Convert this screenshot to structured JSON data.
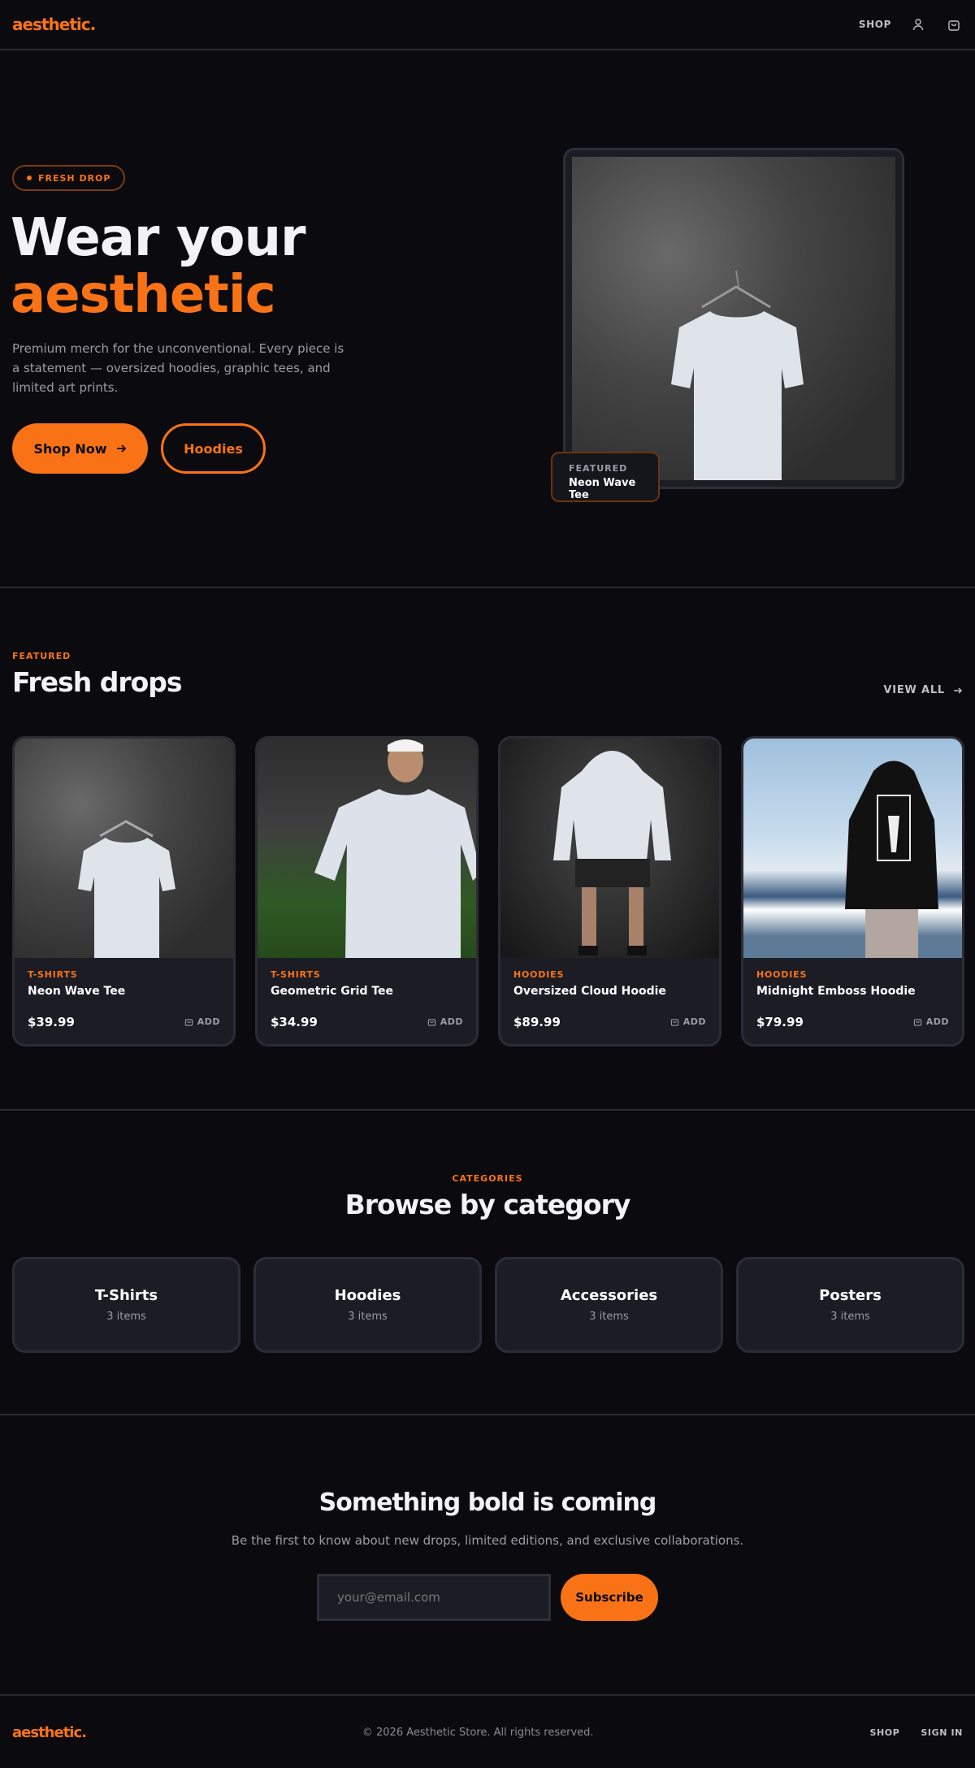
{
  "header": {
    "logo": "aesthetic.",
    "nav_shop": "SHOP",
    "icons": [
      "user-icon",
      "shopping-bag-icon"
    ]
  },
  "hero": {
    "badge": "FRESH DROP",
    "title_line1": "Wear your",
    "title_line2": "aesthetic",
    "description": "Premium merch for the unconventional. Every piece is a statement — oversized hoodies, graphic tees, and limited art prints.",
    "primary_button": "Shop Now",
    "secondary_button": "Hoodies",
    "featured_label": "FEATURED",
    "featured_name": "Neon Wave Tee"
  },
  "drops": {
    "eyebrow": "FEATURED",
    "title": "Fresh drops",
    "view_all": "VIEW ALL",
    "products": [
      {
        "category": "T-SHIRTS",
        "name": "Neon Wave Tee",
        "price": "$39.99",
        "add": "ADD"
      },
      {
        "category": "T-SHIRTS",
        "name": "Geometric Grid Tee",
        "price": "$34.99",
        "add": "ADD"
      },
      {
        "category": "HOODIES",
        "name": "Oversized Cloud Hoodie",
        "price": "$89.99",
        "add": "ADD"
      },
      {
        "category": "HOODIES",
        "name": "Midnight Emboss Hoodie",
        "price": "$79.99",
        "add": "ADD"
      }
    ]
  },
  "categories": {
    "eyebrow": "CATEGORIES",
    "title": "Browse by category",
    "items": [
      {
        "name": "T-Shirts",
        "count": "3 items"
      },
      {
        "name": "Hoodies",
        "count": "3 items"
      },
      {
        "name": "Accessories",
        "count": "3 items"
      },
      {
        "name": "Posters",
        "count": "3 items"
      }
    ]
  },
  "newsletter": {
    "title": "Something bold is coming",
    "description": "Be the first to know about new drops, limited editions, and exclusive collaborations.",
    "placeholder": "your@email.com",
    "button": "Subscribe"
  },
  "footer": {
    "logo": "aesthetic.",
    "copyright": "© 2026 Aesthetic Store. All rights reserved.",
    "link_shop": "SHOP",
    "link_signin": "SIGN IN"
  },
  "colors": {
    "accent": "#f97316",
    "background": "#0b0b0f",
    "card": "#1c1c25"
  }
}
